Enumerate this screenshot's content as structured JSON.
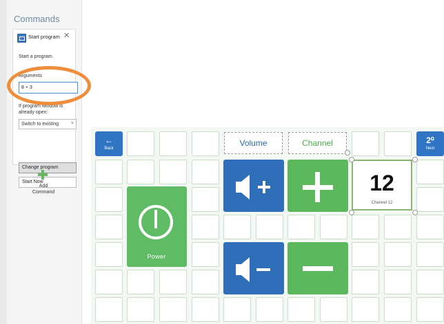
{
  "panel": {
    "title": "Commands",
    "card": {
      "title": "Start program",
      "description": "Start a program.",
      "arguments_label": "Arguments",
      "arguments_value": "8 + 3",
      "option_line1": "If program window is",
      "option_line2": "already open:",
      "select_value": "Switch to existing",
      "change_button": "Change program",
      "start_now_label": "Start Now"
    },
    "add_command_line1": "Add",
    "add_command_line2": "Command"
  },
  "grid": {
    "back": {
      "symbol": "←",
      "label": "Back"
    },
    "next": {
      "symbol": "2⁰",
      "label": "Next"
    },
    "volume_label": "Volume",
    "channel_label": "Channel",
    "power_label": "Power",
    "channel_number": "12",
    "channel_caption": "Channel 12"
  },
  "colors": {
    "accent_blue": "#2f6fb9",
    "accent_green": "#5cb85c",
    "highlight_orange": "#ee8d3c"
  },
  "icons": [
    "plus-icon",
    "close-icon",
    "power-icon",
    "volume-up-icon",
    "volume-down-icon",
    "back-arrow-icon"
  ]
}
